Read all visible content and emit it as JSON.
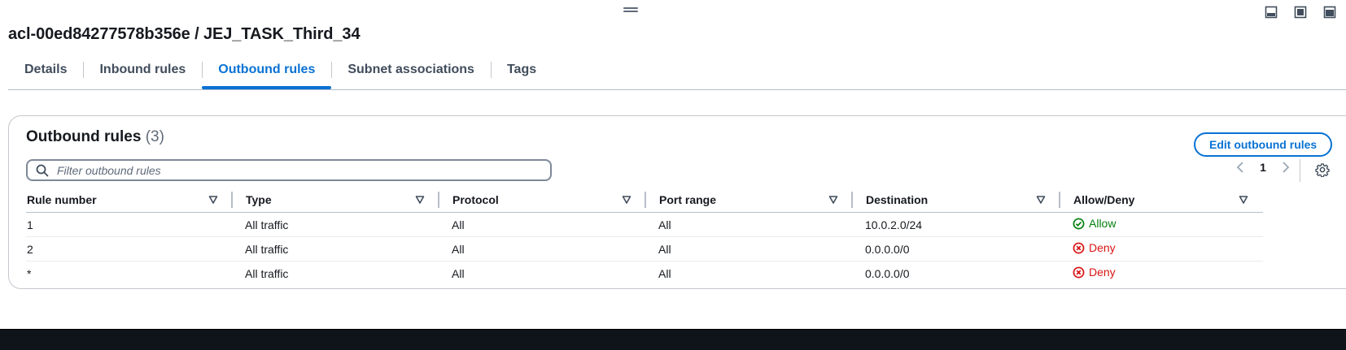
{
  "title": "acl-00ed84277578b356e / JEJ_TASK_Third_34",
  "tabs": [
    {
      "label": "Details"
    },
    {
      "label": "Inbound rules"
    },
    {
      "label": "Outbound rules"
    },
    {
      "label": "Subnet associations"
    },
    {
      "label": "Tags"
    }
  ],
  "active_tab": "Outbound rules",
  "panel": {
    "title": "Outbound rules",
    "count": "(3)",
    "edit_button": "Edit outbound rules",
    "filter_placeholder": "Filter outbound rules",
    "page": "1"
  },
  "table": {
    "columns": [
      "Rule number",
      "Type",
      "Protocol",
      "Port range",
      "Destination",
      "Allow/Deny"
    ],
    "rows": [
      {
        "rule_number": "1",
        "type": "All traffic",
        "protocol": "All",
        "port_range": "All",
        "destination": "10.0.2.0/24",
        "action": "Allow"
      },
      {
        "rule_number": "2",
        "type": "All traffic",
        "protocol": "All",
        "port_range": "All",
        "destination": "0.0.0.0/0",
        "action": "Deny"
      },
      {
        "rule_number": "*",
        "type": "All traffic",
        "protocol": "All",
        "port_range": "All",
        "destination": "0.0.0.0/0",
        "action": "Deny"
      }
    ]
  },
  "colors": {
    "accent": "#0972d3",
    "allow": "#037f0c",
    "deny": "#d91515"
  },
  "icons": {
    "drag_handle": "drag-handle-icon",
    "split_panel": [
      "panel-bottom-icon",
      "panel-side-icon",
      "panel-fullscreen-icon"
    ],
    "filter": "search-icon",
    "pager": [
      "chevron-left-icon",
      "chevron-right-icon"
    ],
    "settings": "gear-icon",
    "sort": "sort-caret-icon",
    "allow": "check-circle-icon",
    "deny": "x-circle-icon"
  }
}
